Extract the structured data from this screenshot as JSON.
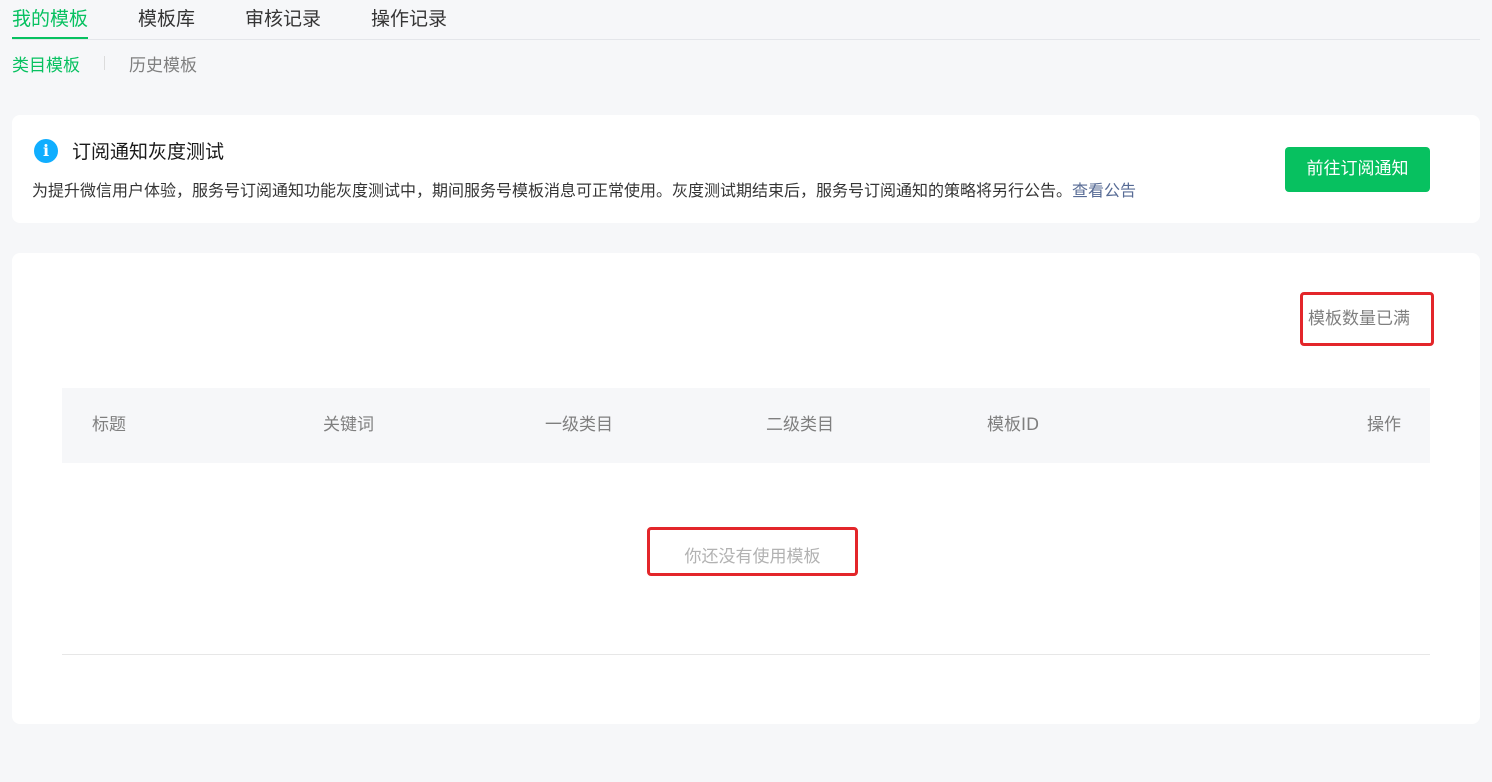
{
  "top_tabs": [
    {
      "label": "我的模板",
      "active": true
    },
    {
      "label": "模板库",
      "active": false
    },
    {
      "label": "审核记录",
      "active": false
    },
    {
      "label": "操作记录",
      "active": false
    }
  ],
  "sub_tabs": [
    {
      "label": "类目模板",
      "active": true
    },
    {
      "label": "历史模板",
      "active": false
    }
  ],
  "notice": {
    "icon": "info-icon",
    "title": "订阅通知灰度测试",
    "description": "为提升微信用户体验，服务号订阅通知功能灰度测试中，期间服务号模板消息可正常使用。灰度测试期结束后，服务号订阅通知的策略将另行公告。",
    "link_text": "查看公告",
    "button_label": "前往订阅通知"
  },
  "main": {
    "status_text": "模板数量已满",
    "table": {
      "columns": [
        "标题",
        "关键词",
        "一级类目",
        "二级类目",
        "模板ID",
        "操作"
      ],
      "empty_text": "你还没有使用模板"
    }
  },
  "colors": {
    "brand_green": "#07c160",
    "info_blue": "#10aeff",
    "link": "#576b95",
    "highlight_red": "#e3262a",
    "background": "#f6f7f9"
  }
}
